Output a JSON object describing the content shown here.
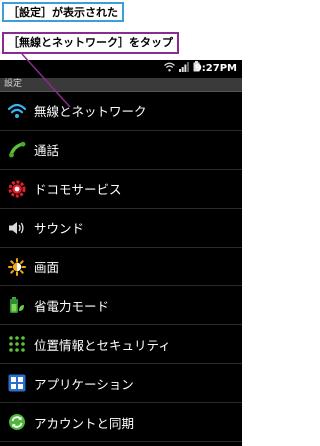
{
  "callouts": {
    "first": "［設定］が表示された",
    "second": "［無線とネットワーク］をタップ"
  },
  "status_bar": {
    "time": "9:27PM",
    "icons": [
      "wifi-icon",
      "signal-icon",
      "battery-icon"
    ]
  },
  "title_bar": {
    "title": "設定"
  },
  "settings": [
    {
      "label": "無線とネットワーク",
      "icon": "wifi-icon"
    },
    {
      "label": "通話",
      "icon": "phone-icon"
    },
    {
      "label": "ドコモサービス",
      "icon": "docomo-gear-icon"
    },
    {
      "label": "サウンド",
      "icon": "speaker-icon"
    },
    {
      "label": "画面",
      "icon": "brightness-icon"
    },
    {
      "label": "省電力モード",
      "icon": "battery-saver-icon"
    },
    {
      "label": "位置情報とセキュリティ",
      "icon": "location-security-icon"
    },
    {
      "label": "アプリケーション",
      "icon": "applications-icon"
    },
    {
      "label": "アカウントと同期",
      "icon": "sync-icon"
    }
  ],
  "colors": {
    "callout_first_border": "#3b9fd8",
    "callout_second_border": "#8b2a8f",
    "background": "#000000",
    "text": "#ffffff"
  }
}
